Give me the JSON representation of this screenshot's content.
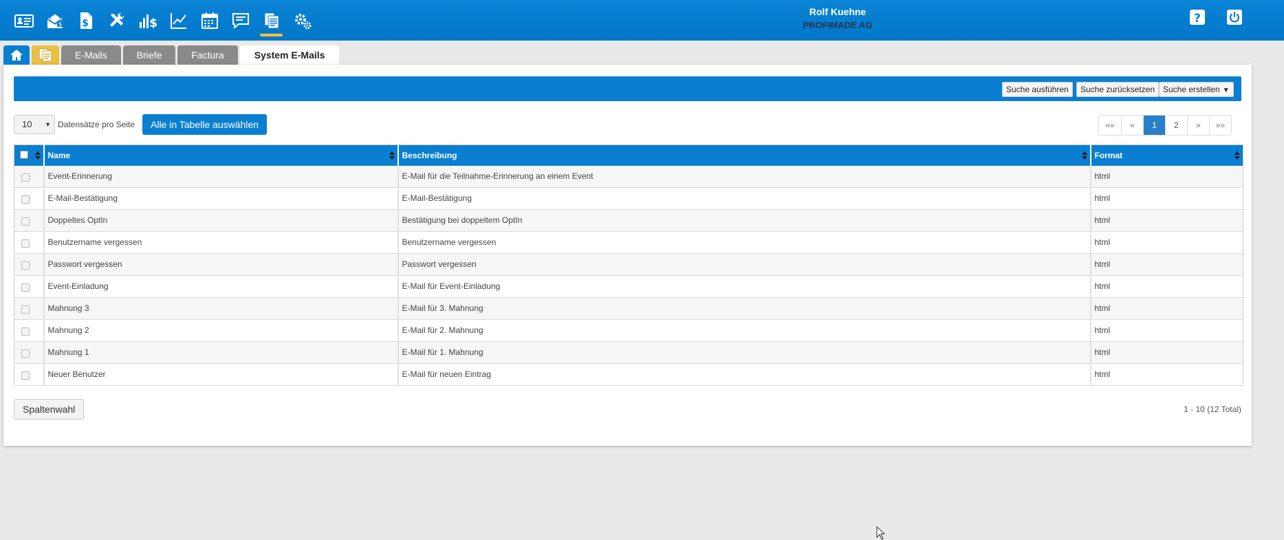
{
  "topbar": {
    "nav": [
      {
        "name": "contacts-icon"
      },
      {
        "name": "mail-icon"
      },
      {
        "name": "invoice-icon"
      },
      {
        "name": "tools-icon"
      },
      {
        "name": "revenue-icon"
      },
      {
        "name": "statistics-icon"
      },
      {
        "name": "calendar-icon"
      },
      {
        "name": "chat-icon"
      },
      {
        "name": "documents-icon",
        "active": true
      },
      {
        "name": "settings-icon"
      }
    ],
    "user_name": "Rolf Kuehne",
    "company": "PROFIMADE AG",
    "help_icon": "help-icon",
    "logout_icon": "power-icon",
    "accent": "#0a7fd1",
    "active_underline": "#f2c23a"
  },
  "tabs": [
    {
      "label": "",
      "icon": "home-icon"
    },
    {
      "label": "",
      "icon": "documents-icon"
    },
    {
      "label": "E-Mails"
    },
    {
      "label": "Briefe"
    },
    {
      "label": "Factura"
    },
    {
      "label": "System E-Mails",
      "active": true
    }
  ],
  "search": {
    "run_label": "Suche ausführen",
    "reset_label": "Suche zurücksetzen",
    "create_label": "Suche erstellen"
  },
  "list": {
    "per_page_value": "10",
    "per_page_label": "Datensätze pro Seite",
    "select_all_label": "Alle in Tabelle auswählen",
    "pager": [
      "««",
      "«",
      "1",
      "2",
      "»",
      "»»"
    ],
    "current_page": "1",
    "columns": [
      "Name",
      "Beschreibung",
      "Format"
    ],
    "rows": [
      [
        "Event-Erinnerung",
        "E-Mail für die Teilnahme-Erinnerung an einem Event",
        "html"
      ],
      [
        "E-Mail-Bestätigung",
        "E-Mail-Bestätigung",
        "html"
      ],
      [
        "Doppeltes OptIn",
        "Bestätigung bei doppeltem OptIn",
        "html"
      ],
      [
        "Benutzername vergessen",
        "Benutzername vergessen",
        "html"
      ],
      [
        "Passwort vergessen",
        "Passwort vergessen",
        "html"
      ],
      [
        "Event-Einladung",
        "E-Mail für Event-Einladung",
        "html"
      ],
      [
        "Mahnung 3",
        "E-Mail für 3. Mahnung",
        "html"
      ],
      [
        "Mahnung 2",
        "E-Mail für 2. Mahnung",
        "html"
      ],
      [
        "Mahnung 1",
        "E-Mail für 1. Mahnung",
        "html"
      ],
      [
        "Neuer Benutzer",
        "E-Mail für neuen Eintrag",
        "html"
      ]
    ],
    "column_choice_label": "Spaltenwahl",
    "total_label": "1 - 10 (12 Total)"
  }
}
